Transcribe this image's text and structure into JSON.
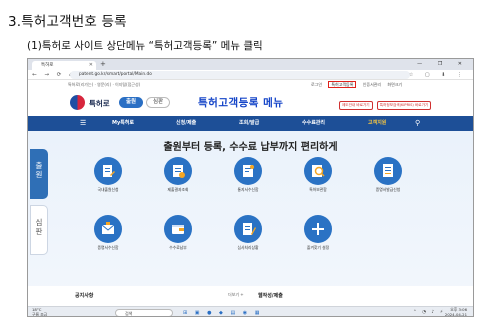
{
  "doc": {
    "title": "3.특허고객번호 등록",
    "step": "(1)특허로 사이트 상단메뉴 “특허고객등록” 메뉴 클릭"
  },
  "browser": {
    "tab_title": "특허로",
    "url": "patent.go.kr/smart/portal/Main.do"
  },
  "site": {
    "util_left": "특허로(리가는) · 영문(리) · 이지털(접근성)",
    "util_items": [
      "로그인",
      "특허고객등록",
      "인증서관리",
      "화면크기"
    ],
    "logo_text": "특허로",
    "toggle_active": "출원",
    "toggle_inactive": "심판",
    "annotation": "특허고객등록 메뉴",
    "outline_buttons": [
      "제도안내 바로가기",
      "특허정보검색(KIPRIS) 바로가기"
    ],
    "nav": [
      "My특허로",
      "신청/제출",
      "조회/발급",
      "수수료관리",
      "고객지원"
    ],
    "nav_active_index": 4,
    "side_tabs": [
      "출\n원",
      "심\n판"
    ],
    "headline": "출원부터 등록, 수수료 납부까지 편리하게",
    "services_row1": [
      "국내출원신청",
      "제출결과조회",
      "통지서수신함",
      "특허보관함",
      "증명서발급신청"
    ],
    "services_row2": [
      "증명서수신함",
      "수수료납부",
      "심사처리상황",
      "즐겨찾기 설정"
    ],
    "notice_title": "공지사항",
    "more_label": "더보기 +",
    "webguide_title": "웹작성/제출"
  },
  "taskbar": {
    "weather": "18°C",
    "weather_desc": "구름 조금",
    "search_placeholder": "검색",
    "time": "오후 3:06",
    "date": "2024-04-21"
  },
  "colors": {
    "brand_blue": "#1d4f97",
    "annotation_blue": "#1545c8",
    "highlight_red": "#e0221b",
    "nav_active": "#f5c542"
  }
}
